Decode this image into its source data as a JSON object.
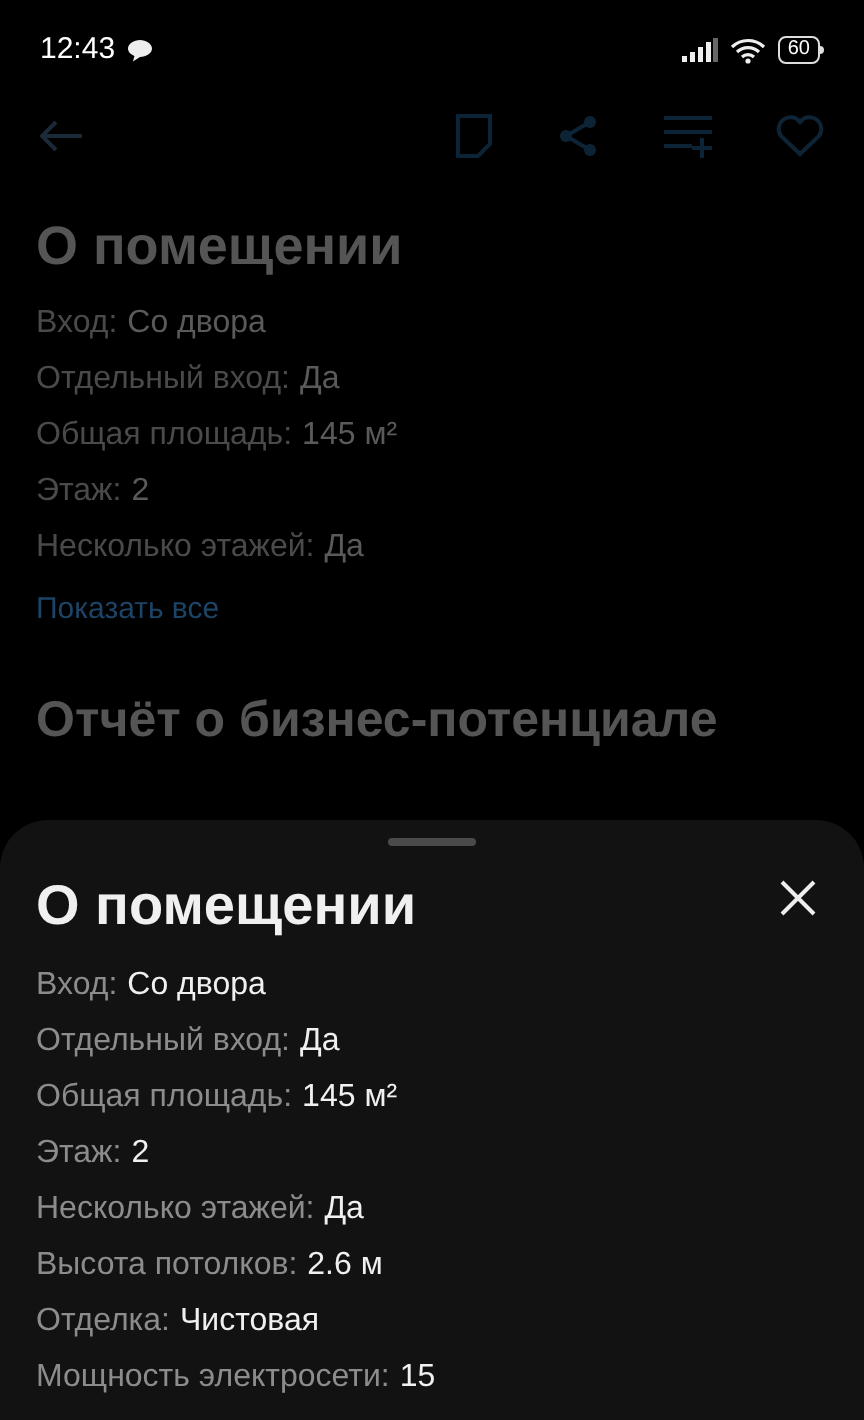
{
  "status_bar": {
    "time": "12:43",
    "battery": "60"
  },
  "page": {
    "title": "О помещении",
    "properties": [
      {
        "label": "Вход:",
        "value": "Со двора"
      },
      {
        "label": "Отдельный вход:",
        "value": "Да"
      },
      {
        "label": "Общая площадь:",
        "value": "145 м²"
      },
      {
        "label": "Этаж:",
        "value": "2"
      },
      {
        "label": "Несколько этажей:",
        "value": "Да"
      }
    ],
    "show_all": "Показать все",
    "next_section_title": "Отчёт о бизнес-потенциале"
  },
  "sheet": {
    "title": "О помещении",
    "properties": [
      {
        "label": "Вход:",
        "value": "Со двора"
      },
      {
        "label": "Отдельный вход:",
        "value": "Да"
      },
      {
        "label": "Общая площадь:",
        "value": "145 м²"
      },
      {
        "label": "Этаж:",
        "value": "2"
      },
      {
        "label": "Несколько этажей:",
        "value": "Да"
      },
      {
        "label": "Высота потолков:",
        "value": "2.6 м"
      },
      {
        "label": "Отделка:",
        "value": "Чистовая"
      },
      {
        "label": "Мощность электросети:",
        "value": "15"
      }
    ]
  }
}
